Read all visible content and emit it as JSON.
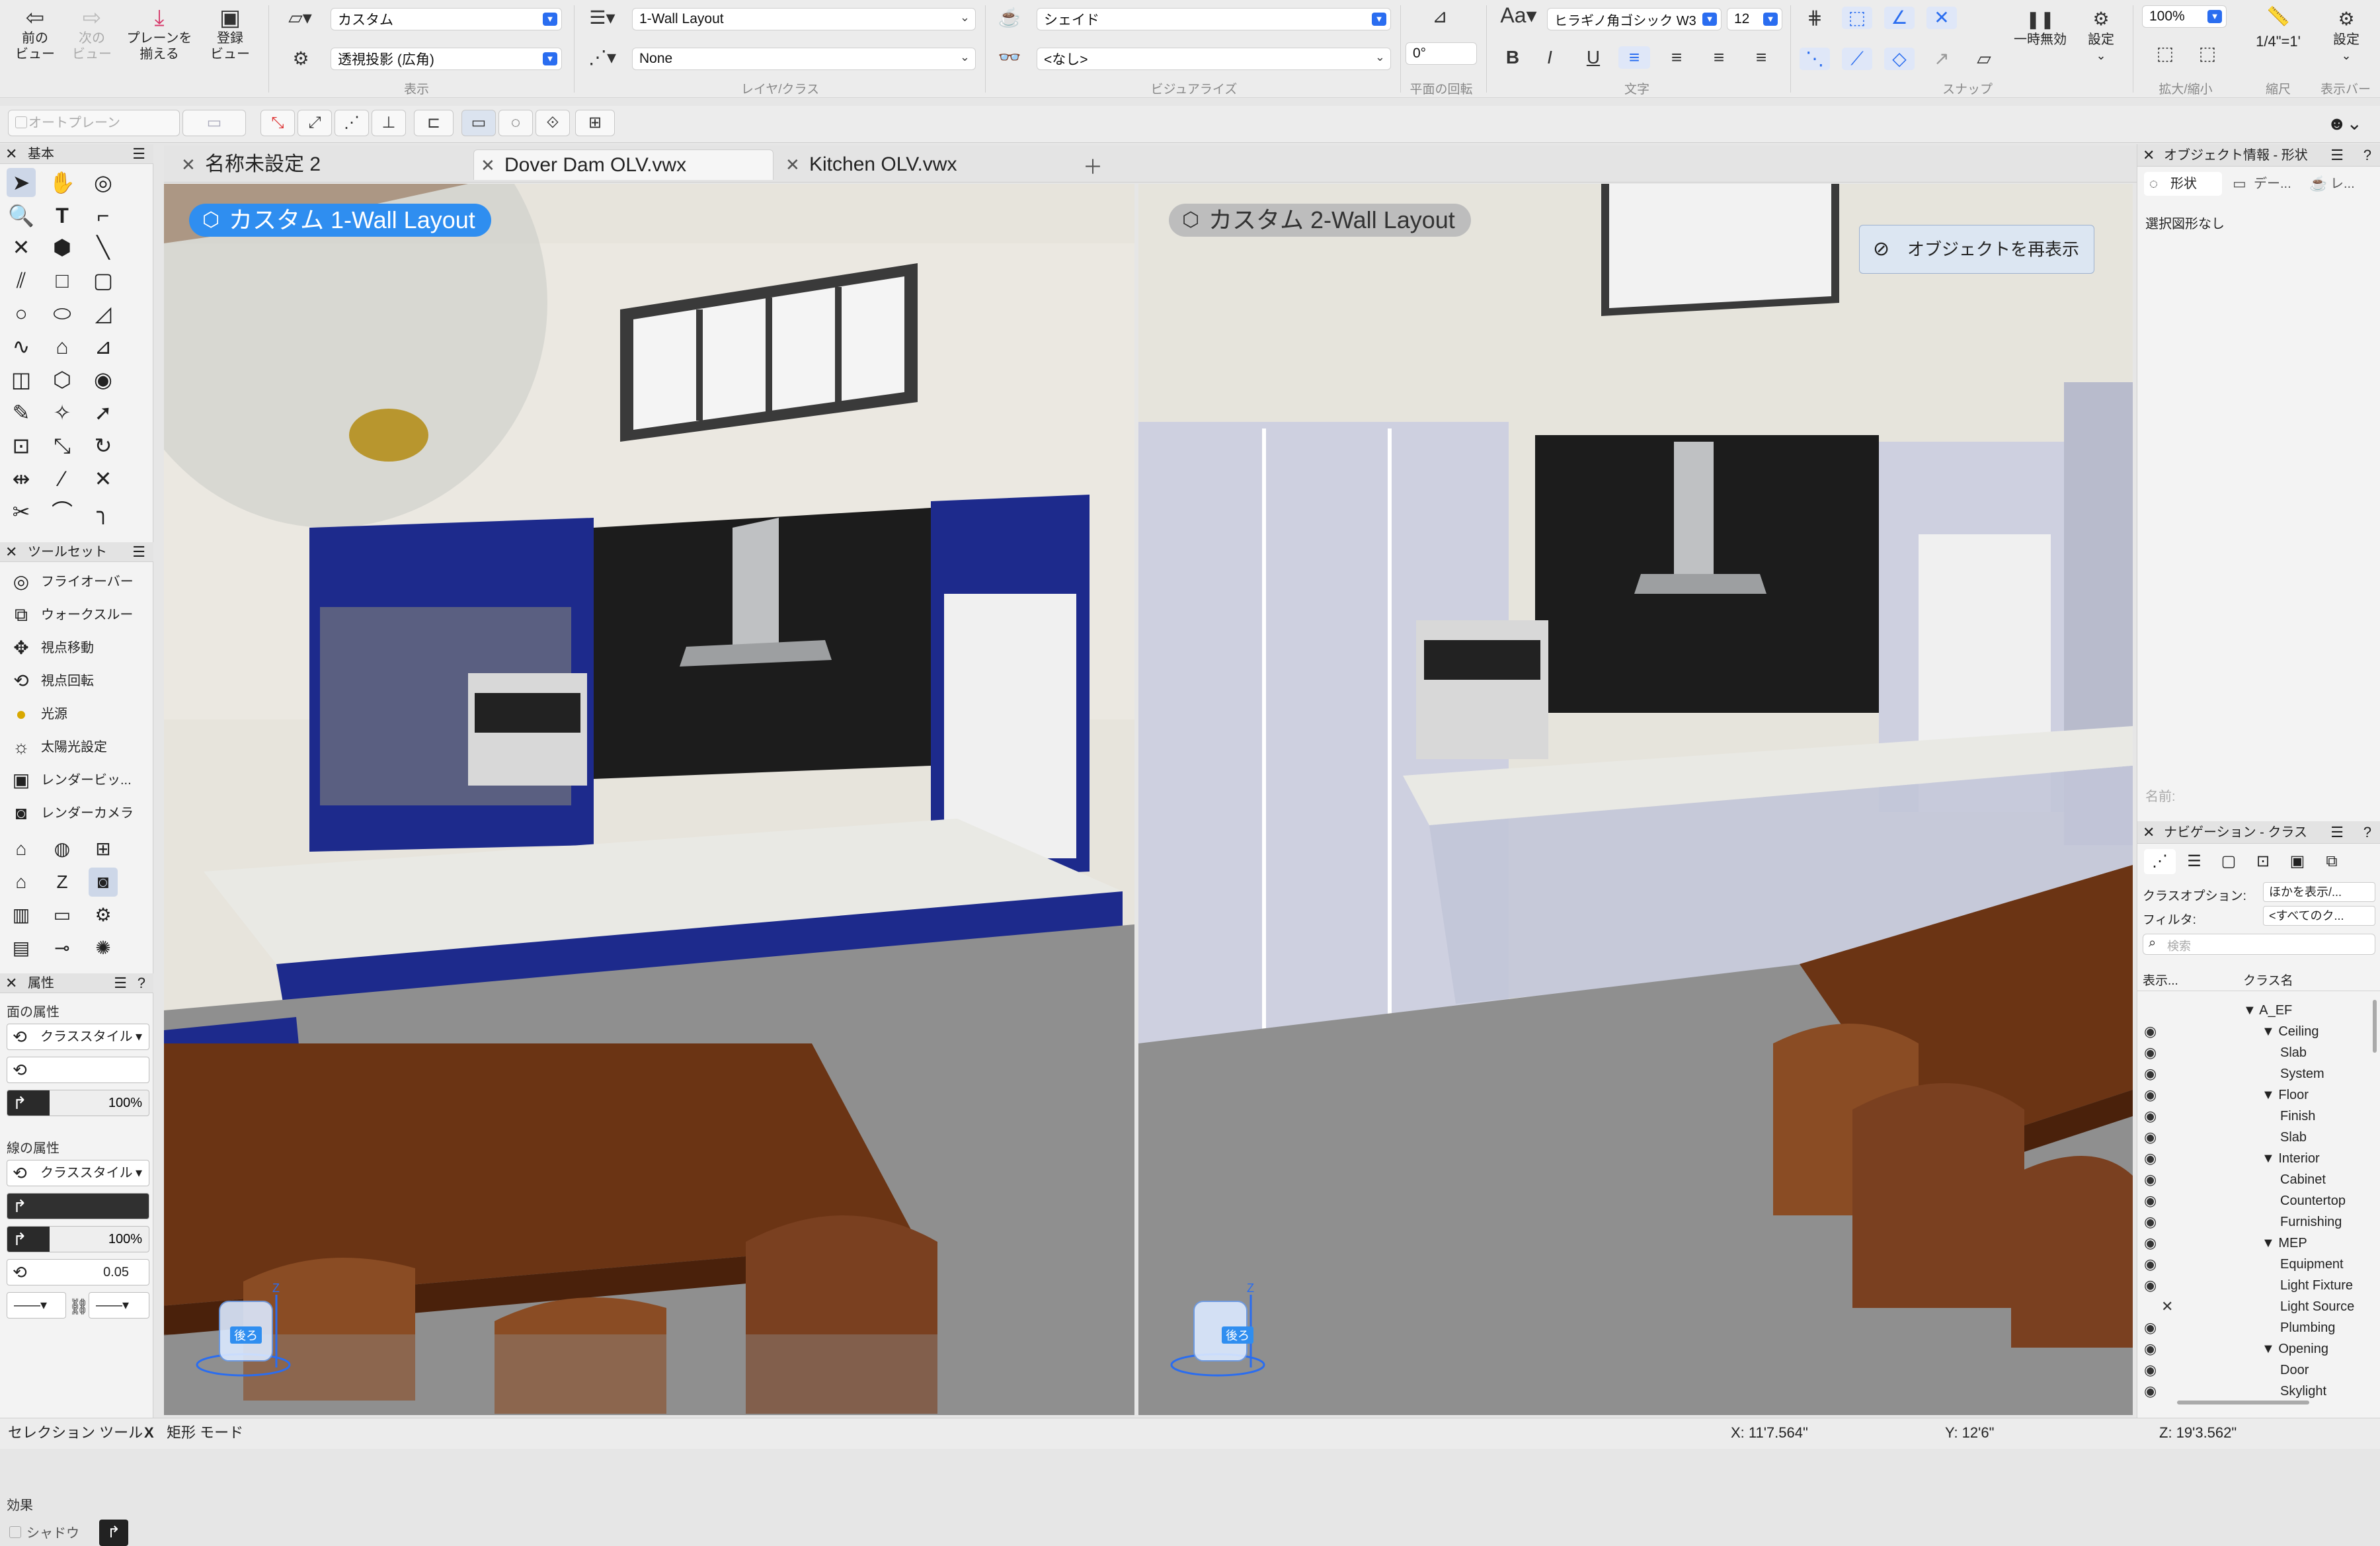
{
  "toolbar": {
    "nav_back": "前の\nビュー",
    "nav_forward": "次の\nビュー",
    "align_planes": "プレーンを\n揃える",
    "saved_view": "登録\nビュー",
    "view_mode": "カスタム",
    "projection": "透視投影 (広角)",
    "group_display": "表示",
    "layer": "1-Wall Layout",
    "class": "None",
    "group_layer_class": "レイヤ/クラス",
    "render_mode": "シェイド",
    "visual_preset": "<なし>",
    "group_visualize": "ビジュアライズ",
    "plane_rotation": "0°",
    "group_plane_rotation": "平面の回転",
    "font_label": "Aa",
    "font": "ヒラギノ角ゴシック W3",
    "font_size": "12",
    "group_text": "文字",
    "group_snap": "スナップ",
    "pause_label": "一時無効",
    "snap_settings_label": "設定",
    "zoom": "100%",
    "group_zoom": "拡大/縮小",
    "scale": "1/4\"=1'",
    "group_scale": "縮尺",
    "settings_label": "設定",
    "group_viewbar": "表示バー"
  },
  "bar2": {
    "auto_plane": "オートプレーン"
  },
  "tabs": [
    {
      "label": "名称未設定 2",
      "active": false
    },
    {
      "label": "Dover Dam OLV.vwx",
      "active": true
    },
    {
      "label": "Kitchen OLV.vwx",
      "active": false
    }
  ],
  "left": {
    "basic_title": "基本",
    "toolset_title": "ツールセット",
    "toolsets": [
      "フライオーバー",
      "ウォークスルー",
      "視点移動",
      "視点回転",
      "光源",
      "太陽光設定",
      "レンダービッ...",
      "レンダーカメラ"
    ],
    "attributes_title": "属性",
    "fill_section": "面の属性",
    "fill_style": "クラススタイル",
    "fill_opacity": "100%",
    "line_section": "線の属性",
    "line_style": "クラススタイル",
    "line_opacity": "100%",
    "line_weight": "0.05",
    "effects_section": "効果",
    "shadow": "シャドウ"
  },
  "viewports": {
    "vp1_label": "カスタム  1-Wall Layout",
    "vp2_label": "カスタム  2-Wall Layout",
    "show_objects_button": "オブジェクトを再表示",
    "cube_back": "後ろ",
    "axis_z": "Z"
  },
  "right": {
    "obj_info_title": "オブジェクト情報 - 形状",
    "tab_shape": "形状",
    "tab_data": "デー...",
    "tab_render": "レ...",
    "no_selection": "選択図形なし",
    "name_label": "名前:",
    "nav_title": "ナビゲーション - クラス",
    "class_options_label": "クラスオプション:",
    "class_options_value": "ほかを表示/...",
    "filter_label": "フィルタ:",
    "filter_value": "<すべてのク...",
    "search_placeholder": "検索",
    "col_visibility": "表示...",
    "col_class_name": "クラス名",
    "classes": [
      {
        "name": "A_EF",
        "level": 0,
        "expanded": true,
        "eye": false
      },
      {
        "name": "Ceiling",
        "level": 1,
        "expanded": true,
        "eye": true
      },
      {
        "name": "Slab",
        "level": 2,
        "eye": true
      },
      {
        "name": "System",
        "level": 2,
        "eye": true
      },
      {
        "name": "Floor",
        "level": 1,
        "expanded": true,
        "eye": true
      },
      {
        "name": "Finish",
        "level": 2,
        "eye": true
      },
      {
        "name": "Slab",
        "level": 2,
        "eye": true
      },
      {
        "name": "Interior",
        "level": 1,
        "expanded": true,
        "eye": true
      },
      {
        "name": "Cabinet",
        "level": 2,
        "eye": true
      },
      {
        "name": "Countertop",
        "level": 2,
        "eye": true
      },
      {
        "name": "Furnishing",
        "level": 2,
        "eye": true
      },
      {
        "name": "MEP",
        "level": 1,
        "expanded": true,
        "eye": true
      },
      {
        "name": "Equipment",
        "level": 2,
        "eye": true
      },
      {
        "name": "Light Fixture",
        "level": 2,
        "eye": true
      },
      {
        "name": "Light Source",
        "level": 2,
        "eye": false,
        "hidden": true
      },
      {
        "name": "Plumbing",
        "level": 2,
        "eye": true
      },
      {
        "name": "Opening",
        "level": 1,
        "expanded": true,
        "eye": true
      },
      {
        "name": "Door",
        "level": 2,
        "eye": true
      },
      {
        "name": "Skylight",
        "level": 2,
        "eye": true
      }
    ]
  },
  "status": {
    "tool": "セレクション ツール",
    "mode_sep": "X",
    "mode": "矩形 モード",
    "x": "X: 11'7.564\"",
    "y": "Y: 12'6\"",
    "z": "Z: 19'3.562\""
  },
  "colors": {
    "accent": "#2f8ef0",
    "cabinet_blue": "#1d2a8c",
    "selected_blue": "#2a6df0"
  }
}
